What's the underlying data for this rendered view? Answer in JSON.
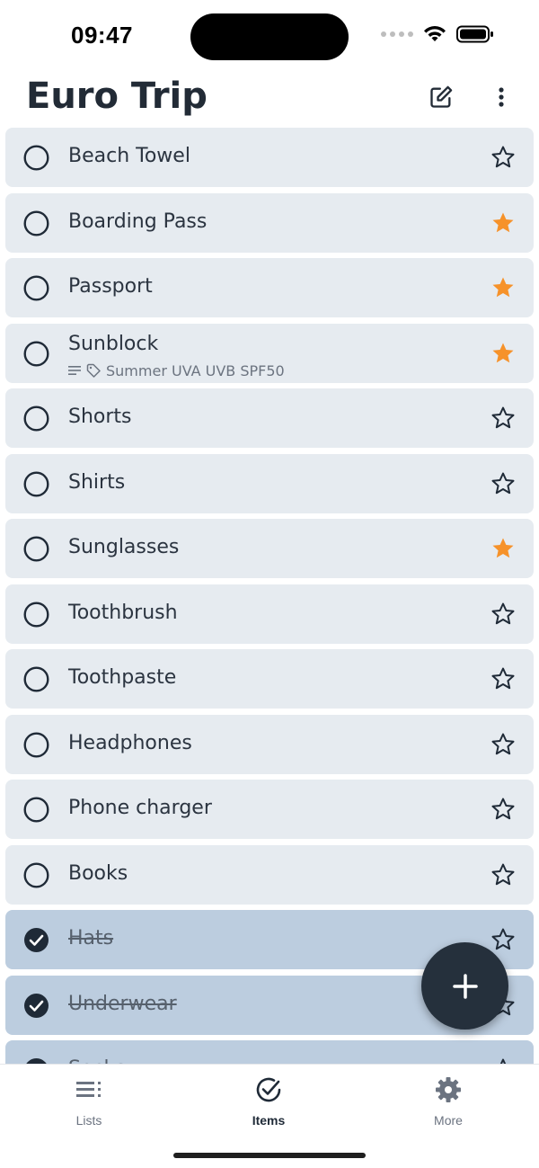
{
  "status_bar": {
    "time": "09:47"
  },
  "header": {
    "title": "Euro Trip",
    "edit_icon": "edit-icon",
    "more_icon": "more-vertical-icon"
  },
  "items": [
    {
      "label": "Beach Towel",
      "checked": false,
      "starred": false
    },
    {
      "label": "Boarding Pass",
      "checked": false,
      "starred": true
    },
    {
      "label": "Passport",
      "checked": false,
      "starred": true
    },
    {
      "label": "Sunblock",
      "checked": false,
      "starred": true,
      "meta": "Summer UVA UVB SPF50"
    },
    {
      "label": "Shorts",
      "checked": false,
      "starred": false
    },
    {
      "label": "Shirts",
      "checked": false,
      "starred": false
    },
    {
      "label": "Sunglasses",
      "checked": false,
      "starred": true
    },
    {
      "label": "Toothbrush",
      "checked": false,
      "starred": false
    },
    {
      "label": "Toothpaste",
      "checked": false,
      "starred": false
    },
    {
      "label": "Headphones",
      "checked": false,
      "starred": false
    },
    {
      "label": "Phone charger",
      "checked": false,
      "starred": false
    },
    {
      "label": "Books",
      "checked": false,
      "starred": false
    },
    {
      "label": "Hats",
      "checked": true,
      "starred": false
    },
    {
      "label": "Underwear",
      "checked": true,
      "starred": false
    },
    {
      "label": "Socks",
      "checked": true,
      "starred": false
    }
  ],
  "fab": {
    "icon": "plus-icon"
  },
  "tabs": [
    {
      "label": "Lists",
      "icon": "list-icon",
      "active": false
    },
    {
      "label": "Items",
      "icon": "check-circle-icon",
      "active": true
    },
    {
      "label": "More",
      "icon": "gear-icon",
      "active": false
    }
  ],
  "colors": {
    "star_active": "#f6922a",
    "row_bg": "#e6ebf0",
    "row_done_bg": "#bccddf",
    "fab_bg": "#25303c"
  }
}
